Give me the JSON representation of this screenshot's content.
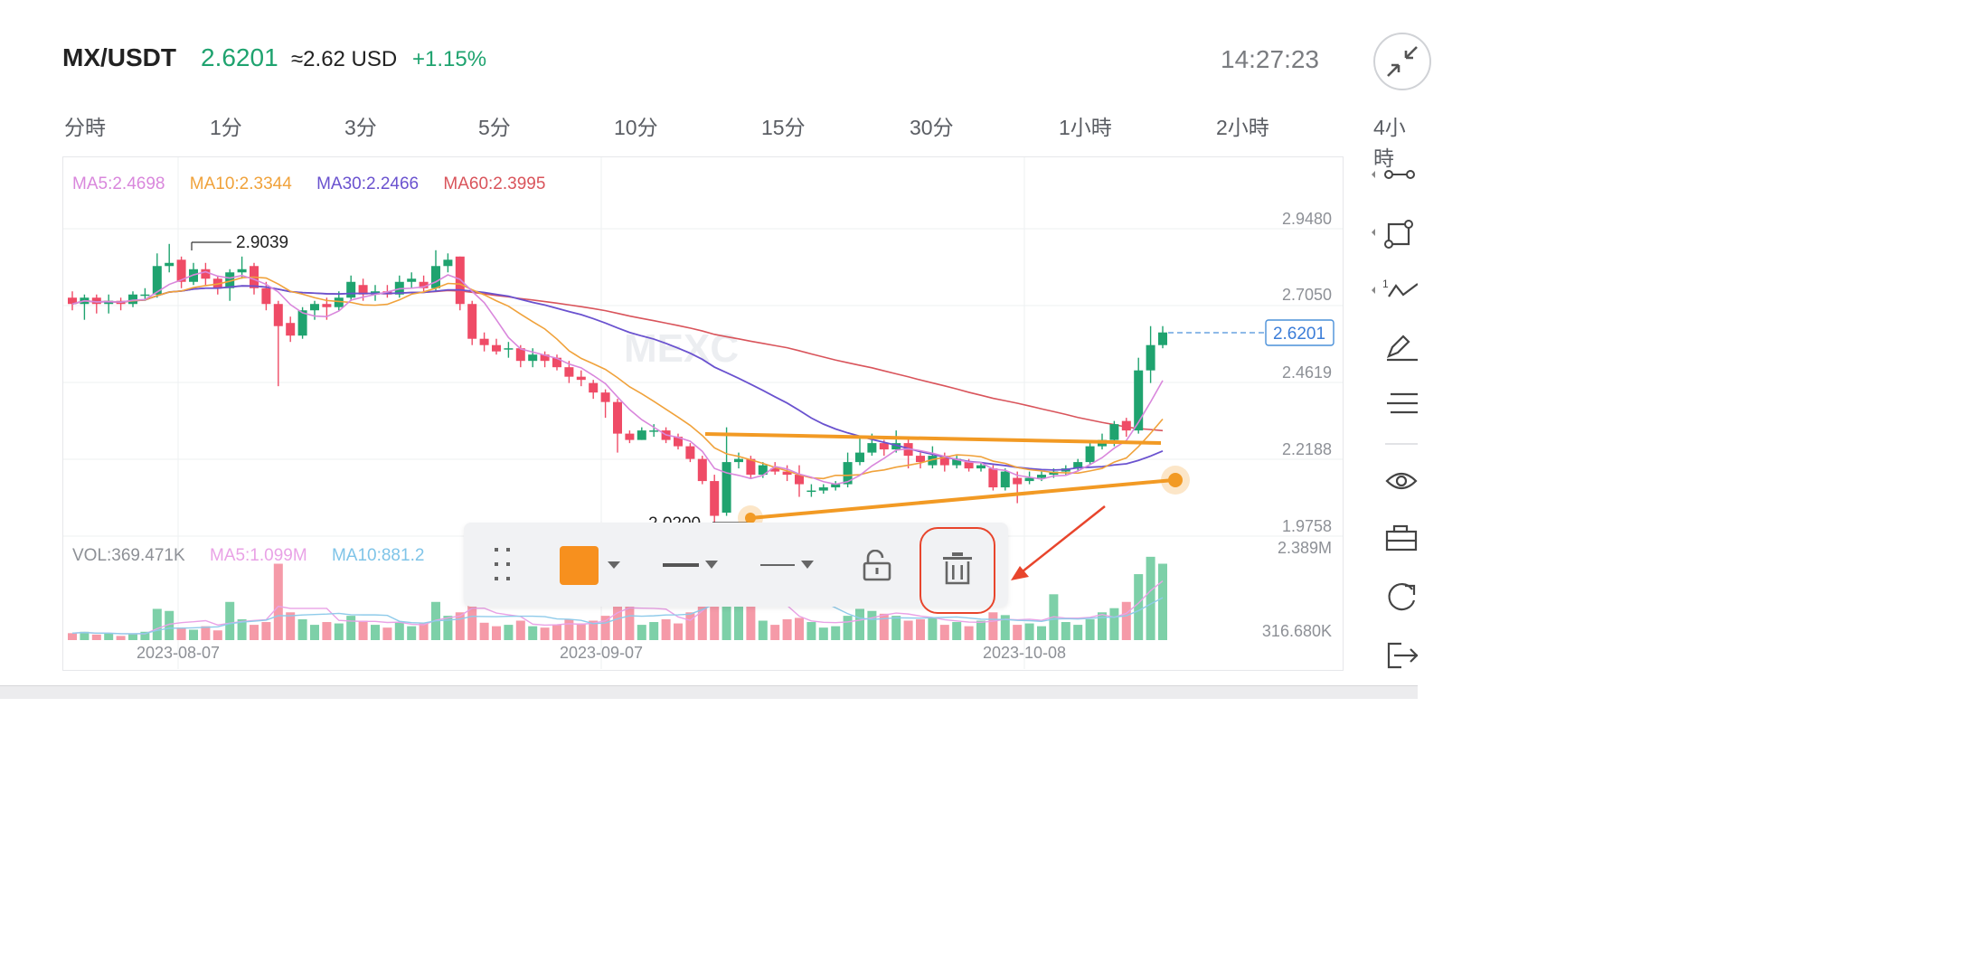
{
  "header": {
    "pair": "MX/USDT",
    "price": "2.6201",
    "usd": "≈2.62 USD",
    "change": "+1.15%",
    "time": "14:27:23"
  },
  "tabs": [
    "分時",
    "1分",
    "3分",
    "5分",
    "10分",
    "15分",
    "30分",
    "1小時",
    "2小時",
    "4小時"
  ],
  "ma_legend": {
    "ma5": "MA5:2.4698",
    "ma10": "MA10:2.3344",
    "ma30": "MA30:2.2466",
    "ma60": "MA60:2.3995"
  },
  "vol_legend": {
    "vol": "VOL:369.471K",
    "ma5": "MA5:1.099M",
    "ma10": "MA10:881.2"
  },
  "price_axis": [
    "2.9480",
    "2.7050",
    "2.4619",
    "2.2188",
    "1.9758"
  ],
  "vol_axis": [
    "2.389M",
    "316.680K"
  ],
  "current_price_tag": "2.6201",
  "annotations": {
    "high": "2.9039",
    "low": "2.0200"
  },
  "dates": [
    "2023-08-07",
    "2023-09-07",
    "2023-10-08"
  ],
  "watermark": "MEXC",
  "toolbar": {
    "color": "#f7901e",
    "items": [
      "drag-handle",
      "color-picker",
      "line-width",
      "line-style",
      "lock",
      "delete"
    ]
  },
  "colors": {
    "up": "#1fa36f",
    "down": "#ef4b66",
    "ma5": "#d987dc",
    "ma10": "#f0a23b",
    "ma30": "#6a52cf",
    "ma60": "#d9545b",
    "trendline": "#f29a24",
    "highlight": "#e8452c"
  },
  "chart_data": {
    "type": "candlestick",
    "symbol": "MX/USDT",
    "y_axis_range": [
      1.9758,
      2.948
    ],
    "candles": [
      {
        "o": 2.73,
        "c": 2.71,
        "h": 2.75,
        "l": 2.69
      },
      {
        "o": 2.71,
        "c": 2.73,
        "h": 2.74,
        "l": 2.66
      },
      {
        "o": 2.73,
        "c": 2.71,
        "h": 2.74,
        "l": 2.68
      },
      {
        "o": 2.71,
        "c": 2.72,
        "h": 2.74,
        "l": 2.68
      },
      {
        "o": 2.72,
        "c": 2.71,
        "h": 2.73,
        "l": 2.69
      },
      {
        "o": 2.71,
        "c": 2.74,
        "h": 2.75,
        "l": 2.7
      },
      {
        "o": 2.74,
        "c": 2.74,
        "h": 2.76,
        "l": 2.72
      },
      {
        "o": 2.74,
        "c": 2.83,
        "h": 2.87,
        "l": 2.73
      },
      {
        "o": 2.83,
        "c": 2.84,
        "h": 2.9,
        "l": 2.81
      },
      {
        "o": 2.85,
        "c": 2.78,
        "h": 2.86,
        "l": 2.76
      },
      {
        "o": 2.78,
        "c": 2.82,
        "h": 2.84,
        "l": 2.77
      },
      {
        "o": 2.82,
        "c": 2.79,
        "h": 2.84,
        "l": 2.77
      },
      {
        "o": 2.79,
        "c": 2.76,
        "h": 2.8,
        "l": 2.74
      },
      {
        "o": 2.76,
        "c": 2.81,
        "h": 2.82,
        "l": 2.72
      },
      {
        "o": 2.81,
        "c": 2.82,
        "h": 2.86,
        "l": 2.79
      },
      {
        "o": 2.83,
        "c": 2.76,
        "h": 2.84,
        "l": 2.74
      },
      {
        "o": 2.76,
        "c": 2.71,
        "h": 2.78,
        "l": 2.69
      },
      {
        "o": 2.71,
        "c": 2.64,
        "h": 2.72,
        "l": 2.45
      },
      {
        "o": 2.65,
        "c": 2.61,
        "h": 2.67,
        "l": 2.59
      },
      {
        "o": 2.61,
        "c": 2.69,
        "h": 2.7,
        "l": 2.6
      },
      {
        "o": 2.69,
        "c": 2.71,
        "h": 2.72,
        "l": 2.66
      },
      {
        "o": 2.71,
        "c": 2.7,
        "h": 2.73,
        "l": 2.66
      },
      {
        "o": 2.7,
        "c": 2.73,
        "h": 2.75,
        "l": 2.69
      },
      {
        "o": 2.73,
        "c": 2.78,
        "h": 2.8,
        "l": 2.72
      },
      {
        "o": 2.77,
        "c": 2.74,
        "h": 2.79,
        "l": 2.72
      },
      {
        "o": 2.74,
        "c": 2.75,
        "h": 2.77,
        "l": 2.72
      },
      {
        "o": 2.75,
        "c": 2.74,
        "h": 2.77,
        "l": 2.73
      },
      {
        "o": 2.74,
        "c": 2.78,
        "h": 2.8,
        "l": 2.73
      },
      {
        "o": 2.78,
        "c": 2.79,
        "h": 2.81,
        "l": 2.76
      },
      {
        "o": 2.78,
        "c": 2.76,
        "h": 2.8,
        "l": 2.75
      },
      {
        "o": 2.76,
        "c": 2.83,
        "h": 2.88,
        "l": 2.75
      },
      {
        "o": 2.83,
        "c": 2.85,
        "h": 2.87,
        "l": 2.81
      },
      {
        "o": 2.86,
        "c": 2.71,
        "h": 2.86,
        "l": 2.69
      },
      {
        "o": 2.71,
        "c": 2.6,
        "h": 2.72,
        "l": 2.58
      },
      {
        "o": 2.6,
        "c": 2.58,
        "h": 2.62,
        "l": 2.56
      },
      {
        "o": 2.58,
        "c": 2.56,
        "h": 2.6,
        "l": 2.55
      },
      {
        "o": 2.57,
        "c": 2.57,
        "h": 2.59,
        "l": 2.54
      },
      {
        "o": 2.57,
        "c": 2.53,
        "h": 2.58,
        "l": 2.51
      },
      {
        "o": 2.53,
        "c": 2.55,
        "h": 2.57,
        "l": 2.51
      },
      {
        "o": 2.55,
        "c": 2.53,
        "h": 2.56,
        "l": 2.51
      },
      {
        "o": 2.54,
        "c": 2.51,
        "h": 2.55,
        "l": 2.5
      },
      {
        "o": 2.51,
        "c": 2.48,
        "h": 2.53,
        "l": 2.46
      },
      {
        "o": 2.48,
        "c": 2.47,
        "h": 2.5,
        "l": 2.45
      },
      {
        "o": 2.46,
        "c": 2.43,
        "h": 2.47,
        "l": 2.41
      },
      {
        "o": 2.43,
        "c": 2.4,
        "h": 2.44,
        "l": 2.35
      },
      {
        "o": 2.4,
        "c": 2.3,
        "h": 2.41,
        "l": 2.24
      },
      {
        "o": 2.3,
        "c": 2.28,
        "h": 2.31,
        "l": 2.27
      },
      {
        "o": 2.28,
        "c": 2.31,
        "h": 2.32,
        "l": 2.28
      },
      {
        "o": 2.31,
        "c": 2.31,
        "h": 2.33,
        "l": 2.29
      },
      {
        "o": 2.31,
        "c": 2.28,
        "h": 2.32,
        "l": 2.27
      },
      {
        "o": 2.29,
        "c": 2.26,
        "h": 2.3,
        "l": 2.25
      },
      {
        "o": 2.26,
        "c": 2.22,
        "h": 2.27,
        "l": 2.21
      },
      {
        "o": 2.22,
        "c": 2.15,
        "h": 2.23,
        "l": 2.14
      },
      {
        "o": 2.15,
        "c": 2.04,
        "h": 2.17,
        "l": 2.02
      },
      {
        "o": 2.05,
        "c": 2.21,
        "h": 2.32,
        "l": 2.04
      },
      {
        "o": 2.21,
        "c": 2.22,
        "h": 2.24,
        "l": 2.19
      },
      {
        "o": 2.22,
        "c": 2.17,
        "h": 2.23,
        "l": 2.16
      },
      {
        "o": 2.17,
        "c": 2.2,
        "h": 2.21,
        "l": 2.16
      },
      {
        "o": 2.19,
        "c": 2.18,
        "h": 2.21,
        "l": 2.17
      },
      {
        "o": 2.18,
        "c": 2.17,
        "h": 2.2,
        "l": 2.15
      },
      {
        "o": 2.17,
        "c": 2.14,
        "h": 2.2,
        "l": 2.1
      },
      {
        "o": 2.12,
        "c": 2.12,
        "h": 2.14,
        "l": 2.1
      },
      {
        "o": 2.12,
        "c": 2.13,
        "h": 2.14,
        "l": 2.11
      },
      {
        "o": 2.13,
        "c": 2.14,
        "h": 2.15,
        "l": 2.12
      },
      {
        "o": 2.14,
        "c": 2.21,
        "h": 2.24,
        "l": 2.13
      },
      {
        "o": 2.21,
        "c": 2.24,
        "h": 2.29,
        "l": 2.2
      },
      {
        "o": 2.24,
        "c": 2.27,
        "h": 2.3,
        "l": 2.23
      },
      {
        "o": 2.27,
        "c": 2.25,
        "h": 2.28,
        "l": 2.23
      },
      {
        "o": 2.25,
        "c": 2.27,
        "h": 2.31,
        "l": 2.24
      },
      {
        "o": 2.27,
        "c": 2.23,
        "h": 2.29,
        "l": 2.19
      },
      {
        "o": 2.23,
        "c": 2.21,
        "h": 2.24,
        "l": 2.19
      },
      {
        "o": 2.2,
        "c": 2.23,
        "h": 2.26,
        "l": 2.19
      },
      {
        "o": 2.23,
        "c": 2.2,
        "h": 2.24,
        "l": 2.18
      },
      {
        "o": 2.2,
        "c": 2.22,
        "h": 2.23,
        "l": 2.19
      },
      {
        "o": 2.21,
        "c": 2.19,
        "h": 2.22,
        "l": 2.18
      },
      {
        "o": 2.19,
        "c": 2.2,
        "h": 2.21,
        "l": 2.18
      },
      {
        "o": 2.19,
        "c": 2.13,
        "h": 2.2,
        "l": 2.12
      },
      {
        "o": 2.13,
        "c": 2.18,
        "h": 2.19,
        "l": 2.12
      },
      {
        "o": 2.16,
        "c": 2.14,
        "h": 2.18,
        "l": 2.08
      },
      {
        "o": 2.15,
        "c": 2.16,
        "h": 2.18,
        "l": 2.14
      },
      {
        "o": 2.16,
        "c": 2.17,
        "h": 2.18,
        "l": 2.15
      },
      {
        "o": 2.17,
        "c": 2.18,
        "h": 2.19,
        "l": 2.16
      },
      {
        "o": 2.18,
        "c": 2.19,
        "h": 2.2,
        "l": 2.17
      },
      {
        "o": 2.19,
        "c": 2.21,
        "h": 2.22,
        "l": 2.18
      },
      {
        "o": 2.21,
        "c": 2.26,
        "h": 2.27,
        "l": 2.2
      },
      {
        "o": 2.26,
        "c": 2.28,
        "h": 2.3,
        "l": 2.25
      },
      {
        "o": 2.28,
        "c": 2.33,
        "h": 2.34,
        "l": 2.26
      },
      {
        "o": 2.34,
        "c": 2.31,
        "h": 2.35,
        "l": 2.29
      },
      {
        "o": 2.31,
        "c": 2.5,
        "h": 2.54,
        "l": 2.3
      },
      {
        "o": 2.5,
        "c": 2.58,
        "h": 2.64,
        "l": 2.46
      },
      {
        "o": 2.58,
        "c": 2.62,
        "h": 2.64,
        "l": 2.57
      }
    ],
    "volume": [
      0.1,
      0.12,
      0.08,
      0.1,
      0.06,
      0.09,
      0.12,
      0.45,
      0.42,
      0.18,
      0.15,
      0.2,
      0.14,
      0.55,
      0.3,
      0.22,
      0.26,
      1.1,
      0.4,
      0.3,
      0.22,
      0.26,
      0.24,
      0.35,
      0.28,
      0.22,
      0.18,
      0.26,
      0.2,
      0.24,
      0.55,
      0.35,
      0.4,
      0.75,
      0.25,
      0.2,
      0.22,
      0.28,
      0.2,
      0.18,
      0.22,
      0.3,
      0.24,
      0.28,
      0.35,
      0.8,
      0.65,
      0.22,
      0.26,
      0.3,
      0.24,
      0.4,
      0.9,
      1.05,
      1.2,
      1.1,
      0.6,
      0.28,
      0.22,
      0.3,
      0.32,
      0.26,
      0.18,
      0.2,
      0.35,
      0.45,
      0.42,
      0.38,
      0.35,
      0.28,
      0.3,
      0.32,
      0.22,
      0.26,
      0.2,
      0.28,
      0.4,
      0.36,
      0.22,
      0.24,
      0.2,
      0.66,
      0.26,
      0.22,
      0.3,
      0.4,
      0.46,
      0.55,
      0.95,
      1.2,
      1.1
    ]
  }
}
